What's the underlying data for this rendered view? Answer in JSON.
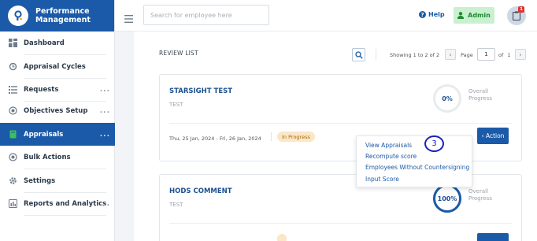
{
  "brand": {
    "title_line1": "Performance",
    "title_line2": "Management"
  },
  "sidebar": {
    "items": [
      {
        "label": "Dashboard",
        "dots": ""
      },
      {
        "label": "Appraisal Cycles",
        "dots": ""
      },
      {
        "label": "Requests",
        "dots": "..."
      },
      {
        "label": "Objectives Setup",
        "dots": "..."
      },
      {
        "label": "Appraisals",
        "dots": "..."
      },
      {
        "label": "Bulk Actions",
        "dots": ""
      },
      {
        "label": "Settings",
        "dots": ""
      },
      {
        "label": "Reports and Analytics",
        "dots": "..."
      }
    ],
    "active_index": 4
  },
  "topbar": {
    "search_placeholder": "Search for employee here",
    "help_label": "Help",
    "admin_label": "Admin",
    "notification_count": "1"
  },
  "review": {
    "title": "REVIEW LIST",
    "showing": "Showing 1 to 2 of 2",
    "page_label": "Page",
    "page_value": "1",
    "of_label": "of",
    "total_pages": "1"
  },
  "cards": [
    {
      "name": "STARSIGHT TEST",
      "sub": "TEST",
      "percent": "0%",
      "percent_value": 0,
      "overall_line1": "Overall",
      "overall_line2": "Progress",
      "dates": "Thu, 25 Jan, 2024 - Fri, 26 Jan, 2024",
      "status": "In Progress",
      "action_label": "‹ Action"
    },
    {
      "name": "HODS COMMENT",
      "sub": "TEST",
      "percent": "100%",
      "percent_value": 100,
      "overall_line1": "Overall",
      "overall_line2": "Progress"
    }
  ],
  "action_menu": {
    "items": [
      "View Appraisals",
      "Recompute score",
      "Employees Without Countersigning",
      "Input Score"
    ]
  },
  "step_marker": "3",
  "colors": {
    "primary": "#1b5aa8",
    "ring_track": "#e8ebee",
    "status_bg": "#fbe7c6",
    "admin_bg": "#c9f0cf"
  }
}
